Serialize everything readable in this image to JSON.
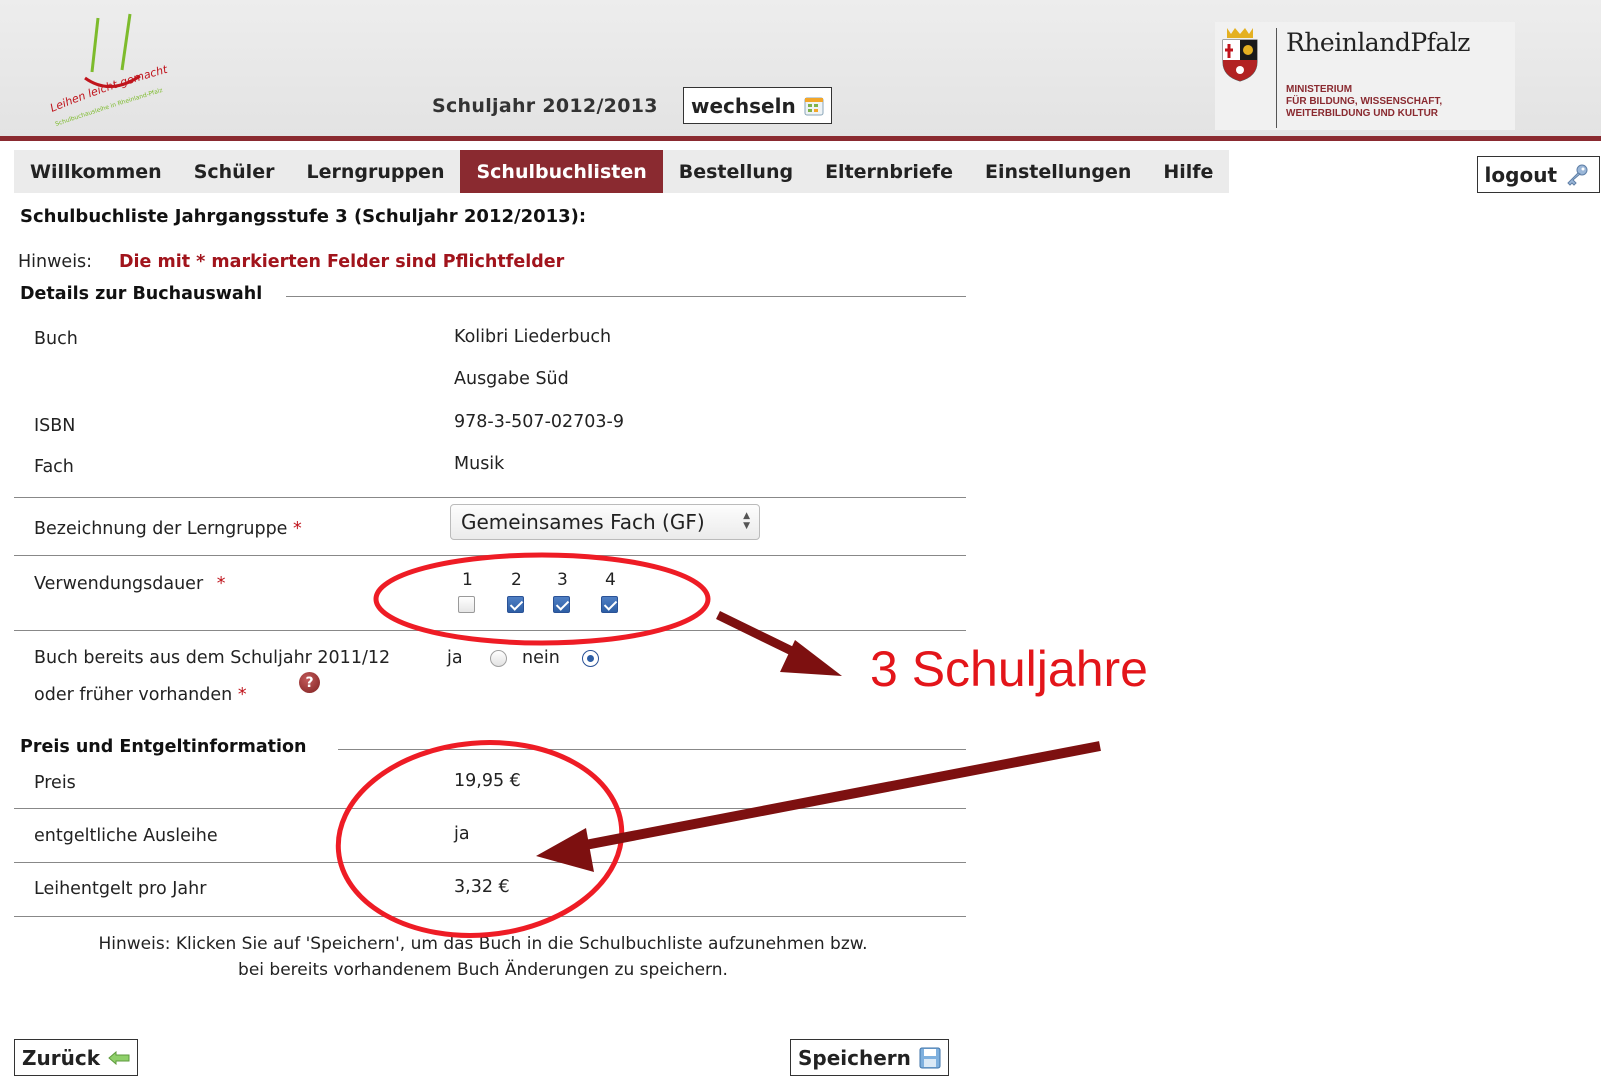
{
  "header": {
    "logo_text": "Leihen leicht gemacht!",
    "logo_subtext": "Schulbuchausleihe in Rheinland-Pfalz",
    "school_year_label": "Schuljahr 2012/2013",
    "change_button": "wechseln",
    "state_name": "RheinlandPfalz",
    "ministry_lines": [
      "MINISTERIUM",
      "FÜR BILDUNG, WISSENSCHAFT,",
      "WEITERBILDUNG UND KULTUR"
    ]
  },
  "nav": {
    "items": [
      "Willkommen",
      "Schüler",
      "Lerngruppen",
      "Schulbuchlisten",
      "Bestellung",
      "Elternbriefe",
      "Einstellungen",
      "Hilfe"
    ],
    "active": "Schulbuchlisten",
    "logout": "logout"
  },
  "page": {
    "heading": "Schulbuchliste Jahrgangsstufe 3 (Schuljahr 2012/2013):",
    "hint_label": "Hinweis:",
    "hint_required": "Die mit * markierten Felder sind Pflichtfelder"
  },
  "book_details": {
    "section_title": "Details zur Buchauswahl",
    "book_label": "Buch",
    "book_title_line1": "Kolibri Liederbuch",
    "book_title_line2": "Ausgabe Süd",
    "isbn_label": "ISBN",
    "isbn_value": "978-3-507-02703-9",
    "subject_label": "Fach",
    "subject_value": "Musik",
    "learning_group_label": "Bezeichnung der Lerngruppe",
    "learning_group_value": "Gemeinsames Fach (GF)",
    "usage_duration_label": "Verwendungsdauer",
    "usage_years": [
      {
        "label": "1",
        "checked": false
      },
      {
        "label": "2",
        "checked": true
      },
      {
        "label": "3",
        "checked": true
      },
      {
        "label": "4",
        "checked": true
      }
    ],
    "already_available_line1": "Buch bereits aus dem Schuljahr 2011/12",
    "already_available_line2": "oder früher vorhanden",
    "yes_label": "ja",
    "no_label": "nein",
    "selected_option": "nein",
    "required_mark": "*"
  },
  "price_info": {
    "section_title": "Preis und Entgeltinformation",
    "price_label": "Preis",
    "price_value": "19,95 €",
    "paid_loan_label": "entgeltliche Ausleihe",
    "paid_loan_value": "ja",
    "fee_label": "Leihentgelt pro Jahr",
    "fee_value": "3,32 €"
  },
  "footer": {
    "save_hint_line1": "Hinweis: Klicken Sie auf 'Speichern', um das Buch in die Schulbuchliste aufzunehmen bzw.",
    "save_hint_line2": "bei bereits vorhandenem Buch Änderungen zu speichern.",
    "back_button": "Zurück",
    "save_button": "Speichern"
  },
  "annotation": {
    "text": "3 Schuljahre",
    "circle_color": "#ee1c25",
    "arrow_color": "#7d1010"
  },
  "colors": {
    "brand": "#8a2a30",
    "required": "#a1141c",
    "checkbox_blue": "#2d5ea5"
  }
}
